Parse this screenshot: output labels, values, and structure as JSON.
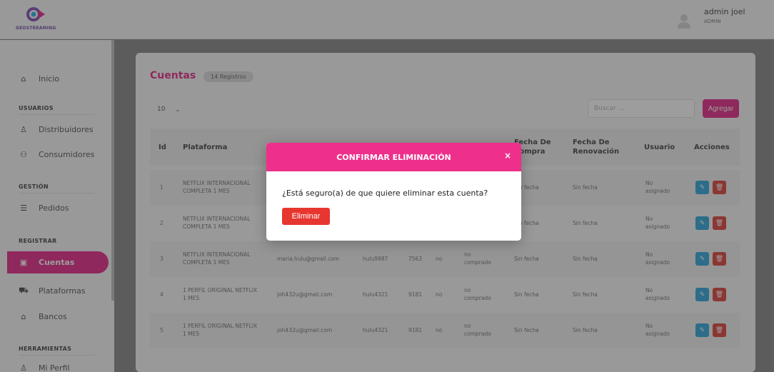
{
  "app": {
    "logo_text": "GEOSTREAMING"
  },
  "user": {
    "name": "admin joel",
    "role": "ADMIN"
  },
  "sidebar": {
    "inicio": "Inicio",
    "sections": [
      "USUARIOS",
      "GESTIÓN",
      "REGISTRAR",
      "HERRAMIENTAS"
    ],
    "items": {
      "distribuidores": "Distribuidores",
      "consumidores": "Consumidores",
      "pedidos": "Pedidos",
      "cuentas": "Cuentas",
      "plataformas": "Plataformas",
      "bancos": "Bancos",
      "perfil": "Mi Perfil"
    }
  },
  "page": {
    "title": "Cuentas",
    "count_badge": "14 Registros",
    "page_length": "10",
    "search_placeholder": "Buscar ...",
    "add_label": "Agregar"
  },
  "table": {
    "headers": {
      "id": "Id",
      "plataforma": "Plataforma",
      "fecha_compra": "Fecha De Compra",
      "fecha_renovacion": "Fecha De Renovación",
      "usuario": "Usuario",
      "acciones": "Acciones"
    },
    "rows": [
      {
        "id": "1",
        "plataforma": "NETFLIX INTERNACIONAL COMPLETA 1 MES",
        "correo": "",
        "pass": "",
        "pin": "",
        "flag": "",
        "estado": "",
        "compra": "Sin fecha",
        "renovacion": "Sin fecha",
        "usuario": "No asignado"
      },
      {
        "id": "2",
        "plataforma": "NETFLIX INTERNACIONAL COMPLETA 1 MES",
        "correo": "",
        "pass": "",
        "pin": "",
        "flag": "",
        "estado": "",
        "compra": "Sin fecha",
        "renovacion": "Sin fecha",
        "usuario": "No asignado"
      },
      {
        "id": "3",
        "plataforma": "NETFLIX INTERNACIONAL COMPLETA 1 MES",
        "correo": "maria.hulu@gmail.com",
        "pass": "hulu9987",
        "pin": "7563",
        "flag": "no",
        "estado": "no comprado",
        "compra": "Sin fecha",
        "renovacion": "Sin fecha",
        "usuario": "No asignado"
      },
      {
        "id": "4",
        "plataforma": "1 PERFIL ORIGINAL NETFLIX 1 MES",
        "correo": "joh432u@gmail.com",
        "pass": "hulu4321",
        "pin": "9181",
        "flag": "no",
        "estado": "no comprado",
        "compra": "Sin fecha",
        "renovacion": "Sin fecha",
        "usuario": "No asignado"
      },
      {
        "id": "5",
        "plataforma": "1 PERFIL ORIGINAL NETFLIX 1 MES",
        "correo": "joh432u@gmail.com",
        "pass": "hulu4321",
        "pin": "9181",
        "flag": "no",
        "estado": "no comprado",
        "compra": "Sin fecha",
        "renovacion": "Sin fecha",
        "usuario": "No asignado"
      }
    ]
  },
  "modal": {
    "title": "CONFIRMAR ELIMINACIÓN",
    "close": "×",
    "message": "¿Está seguro(a) de que quiere eliminar esta cuenta?",
    "confirm_label": "Eliminar"
  },
  "colors": {
    "accent": "#e3157c",
    "modal_header": "#ee2f8b",
    "danger": "#e7362f",
    "edit": "#1e9fd8"
  }
}
